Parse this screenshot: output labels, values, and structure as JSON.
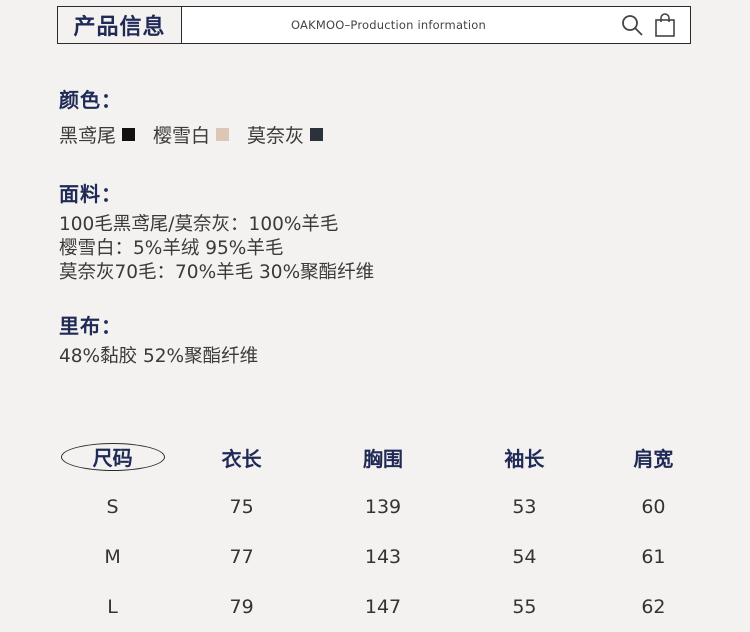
{
  "header": {
    "title": "产品信息",
    "subtitle": "OAKMOO–Production information",
    "icons": [
      "search-icon",
      "shopping-bag-icon"
    ]
  },
  "color_section": {
    "title": "颜色：",
    "items": [
      {
        "name": "黑鸢尾",
        "swatch": "#111111"
      },
      {
        "name": "樱雪白",
        "swatch": "#dcc7b7"
      },
      {
        "name": "莫奈灰",
        "swatch": "#2b323b"
      }
    ]
  },
  "fabric_section": {
    "title": "面料：",
    "lines": [
      "100毛黑鸢尾/莫奈灰：100%羊毛",
      "樱雪白：5%羊绒 95%羊毛",
      "莫奈灰70毛：70%羊毛 30%聚酯纤维"
    ]
  },
  "lining_section": {
    "title": "里布：",
    "lines": [
      "48%黏胶 52%聚酯纤维"
    ]
  },
  "size_table": {
    "headers": [
      "尺码",
      "衣长",
      "胸围",
      "袖长",
      "肩宽"
    ],
    "rows": [
      [
        "S",
        "75",
        "139",
        "53",
        "60"
      ],
      [
        "M",
        "77",
        "143",
        "54",
        "61"
      ],
      [
        "L",
        "79",
        "147",
        "55",
        "62"
      ]
    ]
  }
}
